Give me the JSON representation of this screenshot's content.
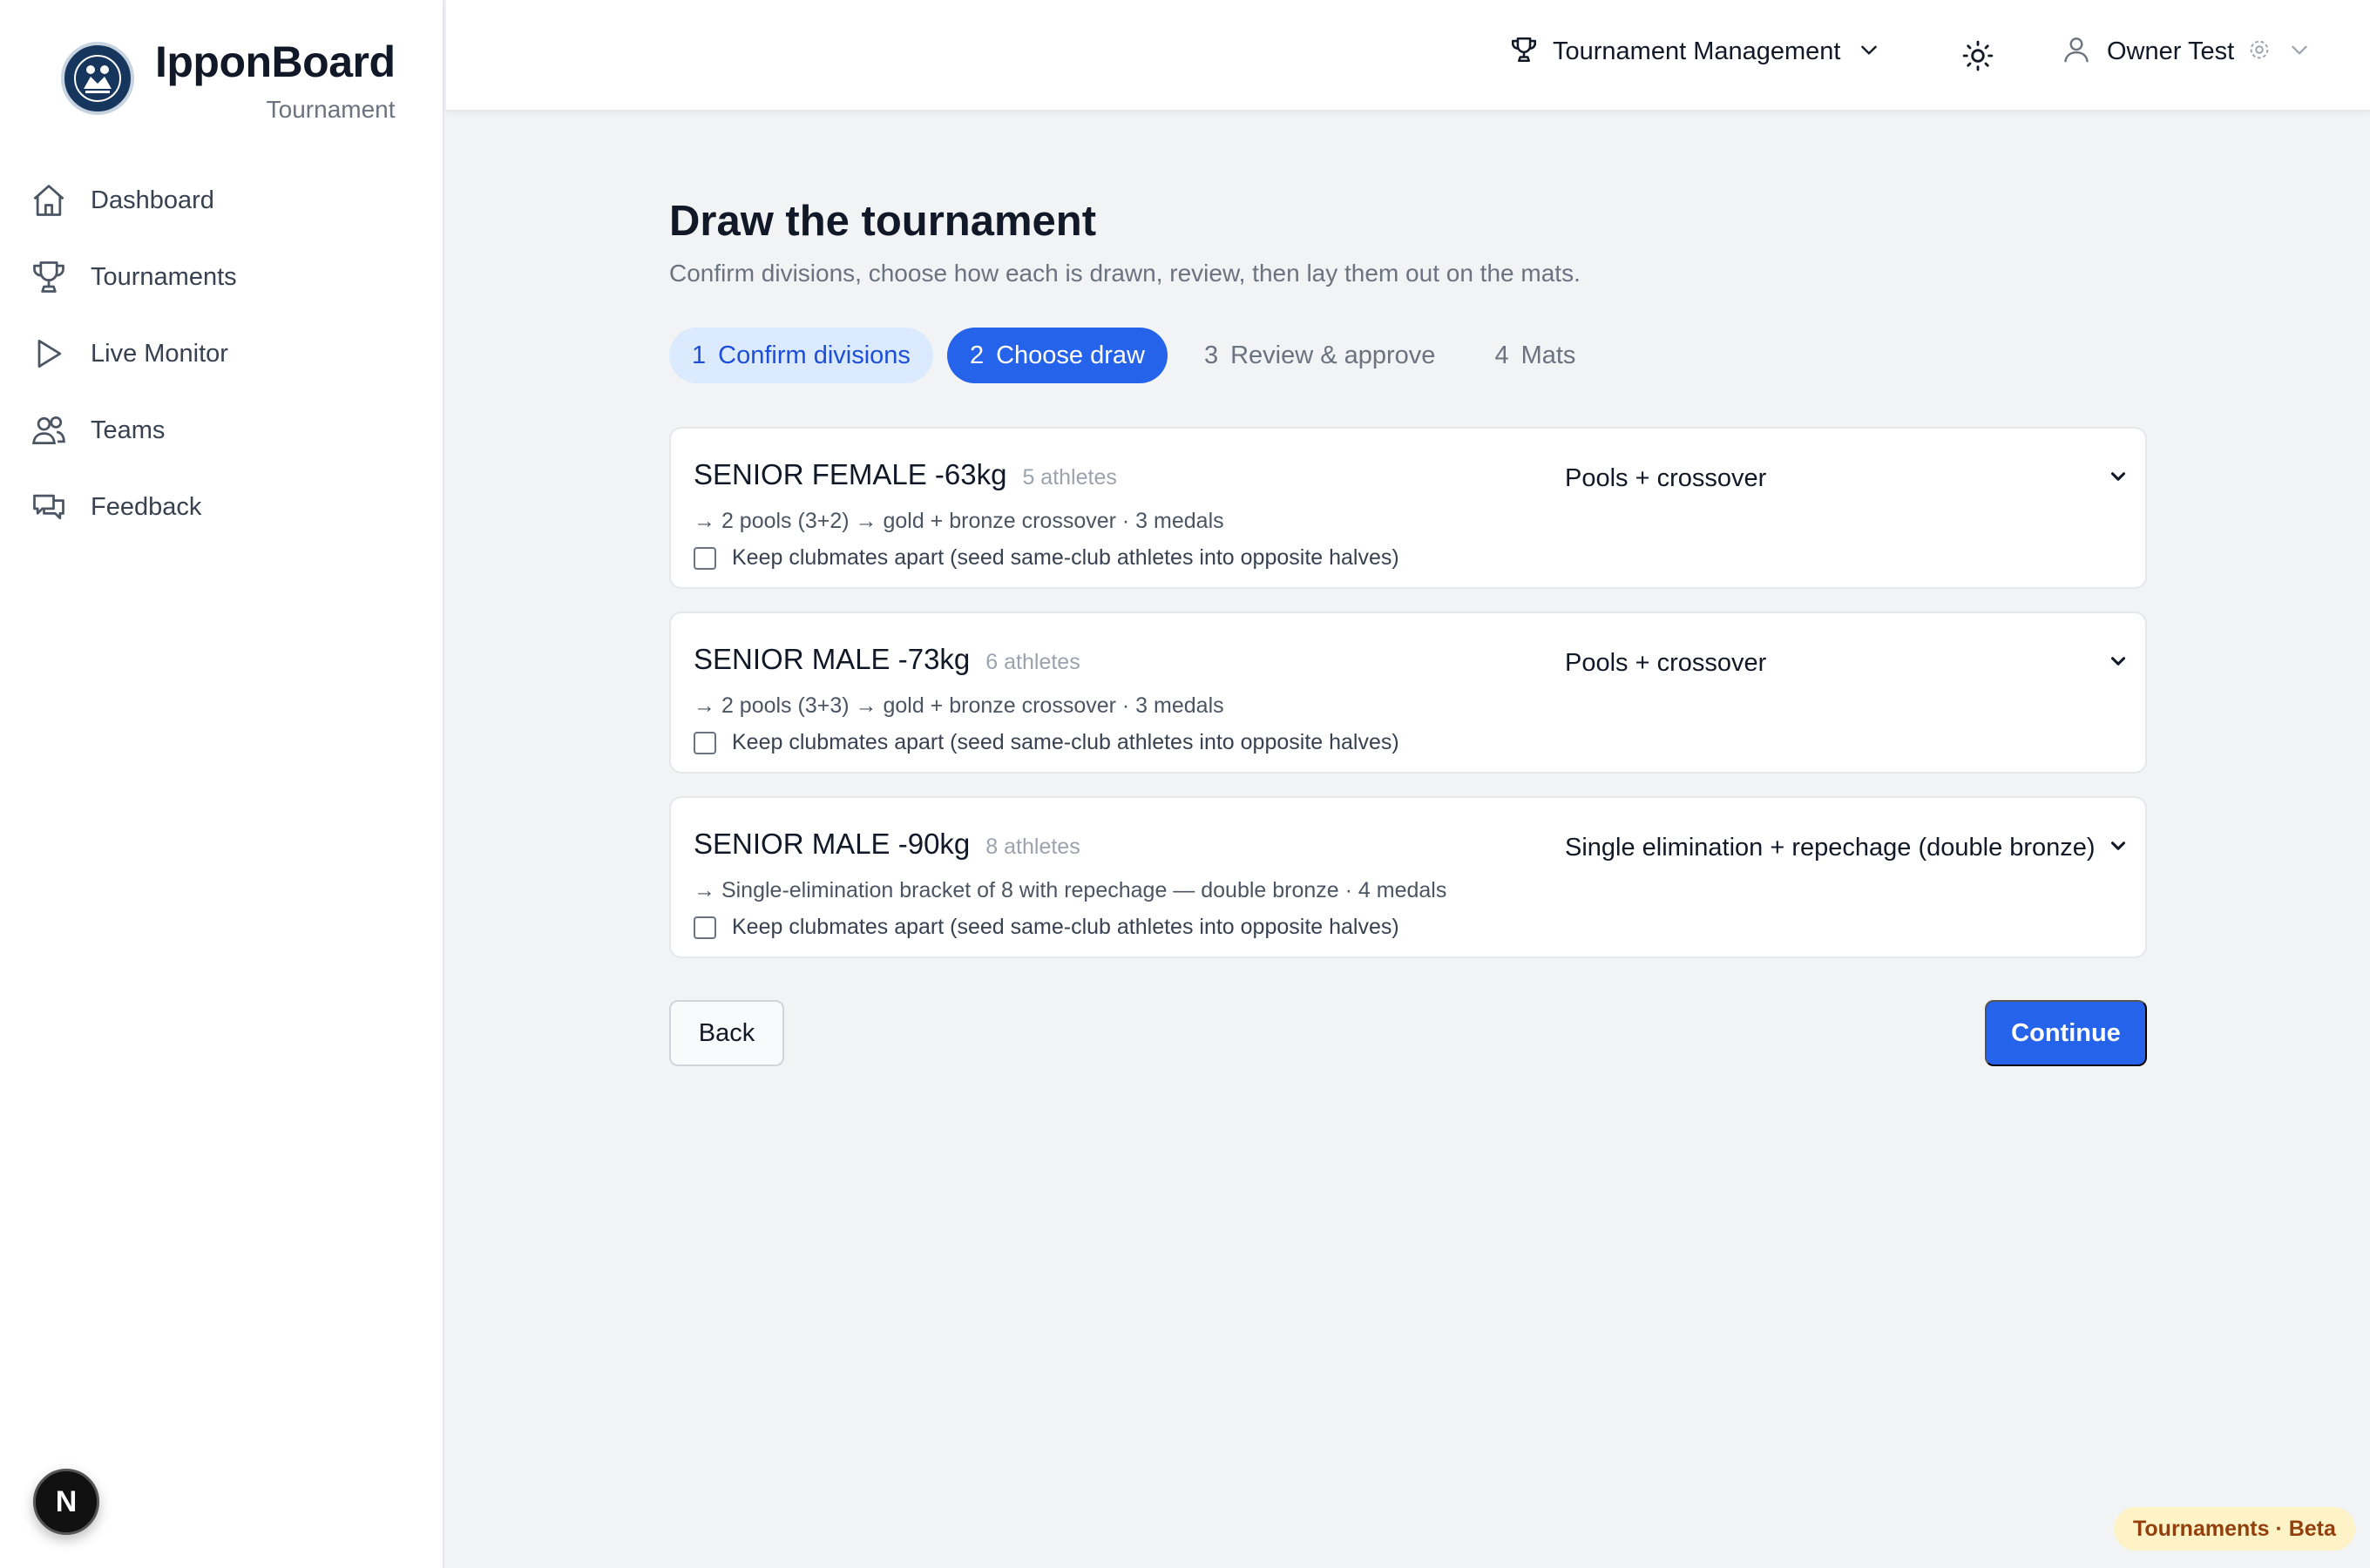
{
  "brand": {
    "name": "IpponBoard",
    "subtitle": "Tournament"
  },
  "sidebar": {
    "items": [
      {
        "label": "Dashboard",
        "icon": "home-icon"
      },
      {
        "label": "Tournaments",
        "icon": "trophy-icon"
      },
      {
        "label": "Live Monitor",
        "icon": "play-icon"
      },
      {
        "label": "Teams",
        "icon": "users-icon"
      },
      {
        "label": "Feedback",
        "icon": "chat-icon"
      }
    ],
    "n_badge": "N"
  },
  "topbar": {
    "menu_label": "Tournament Management",
    "user_name": "Owner Test"
  },
  "page": {
    "title": "Draw the tournament",
    "subtitle": "Confirm divisions, choose how each is drawn, review, then lay them out on the mats."
  },
  "steps": [
    {
      "num": "1",
      "label": "Confirm divisions",
      "state": "done"
    },
    {
      "num": "2",
      "label": "Choose draw",
      "state": "active"
    },
    {
      "num": "3",
      "label": "Review & approve",
      "state": "todo"
    },
    {
      "num": "4",
      "label": "Mats",
      "state": "todo"
    }
  ],
  "divisions": [
    {
      "name": "SENIOR FEMALE -63kg",
      "count": "5 athletes",
      "description": "→ 2 pools (3+2) → gold + bronze crossover · 3 medals",
      "checkbox_label": "Keep clubmates apart (seed same-club athletes into opposite halves)",
      "checked": false,
      "draw": "Pools + crossover"
    },
    {
      "name": "SENIOR MALE -73kg",
      "count": "6 athletes",
      "description": "→ 2 pools (3+3) → gold + bronze crossover · 3 medals",
      "checkbox_label": "Keep clubmates apart (seed same-club athletes into opposite halves)",
      "checked": false,
      "draw": "Pools + crossover"
    },
    {
      "name": "SENIOR MALE -90kg",
      "count": "8 athletes",
      "description": "→ Single-elimination bracket of 8 with repechage — double bronze · 4 medals",
      "checkbox_label": "Keep clubmates apart (seed same-club athletes into opposite halves)",
      "checked": false,
      "draw": "Single elimination + repechage (double bronze)"
    }
  ],
  "actions": {
    "back": "Back",
    "continue": "Continue"
  },
  "badge": "Tournaments · Beta",
  "colors": {
    "primary": "#2563eb",
    "primary_light": "#dbeafe",
    "logo": "#17365d"
  }
}
